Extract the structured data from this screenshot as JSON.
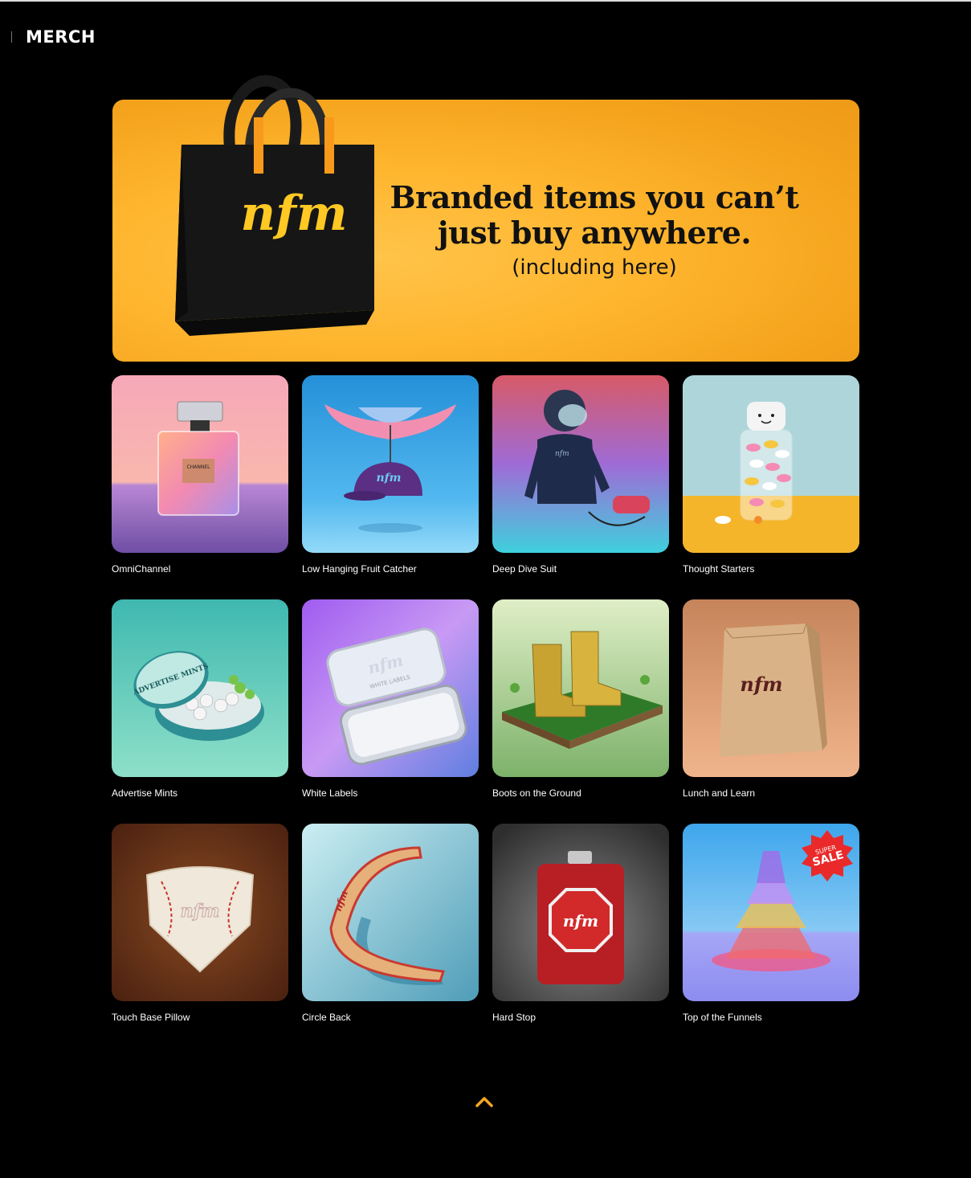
{
  "header": {
    "logo": "MERCH"
  },
  "hero": {
    "title_line1": "Branded items you can’t",
    "title_line2": "just buy anywhere.",
    "subtitle": "(including here)",
    "bag_logo": "nfm"
  },
  "products": [
    {
      "name": "OmniChannel",
      "image_label": "CHANNEL"
    },
    {
      "name": "Low Hanging Fruit Catcher",
      "image_label": "nfm"
    },
    {
      "name": "Deep Dive Suit",
      "image_label": "nfm"
    },
    {
      "name": "Thought Starters",
      "image_label": ""
    },
    {
      "name": "Advertise Mints",
      "image_label": "ADVERTISE MINTS"
    },
    {
      "name": "White Labels",
      "image_label": "WHITE LABELS"
    },
    {
      "name": "Boots on the Ground",
      "image_label": ""
    },
    {
      "name": "Lunch and Learn",
      "image_label": "nfm"
    },
    {
      "name": "Touch Base Pillow",
      "image_label": "nfm"
    },
    {
      "name": "Circle Back",
      "image_label": "nfm"
    },
    {
      "name": "Hard Stop",
      "image_label": "nfm"
    },
    {
      "name": "Top of the Funnels",
      "image_label": "SUPER SALE"
    }
  ],
  "badge": {
    "top": "SUPER",
    "bottom": "SALE"
  },
  "back_to_top": {
    "icon": "chevron-up-icon",
    "color": "#f5a623"
  }
}
